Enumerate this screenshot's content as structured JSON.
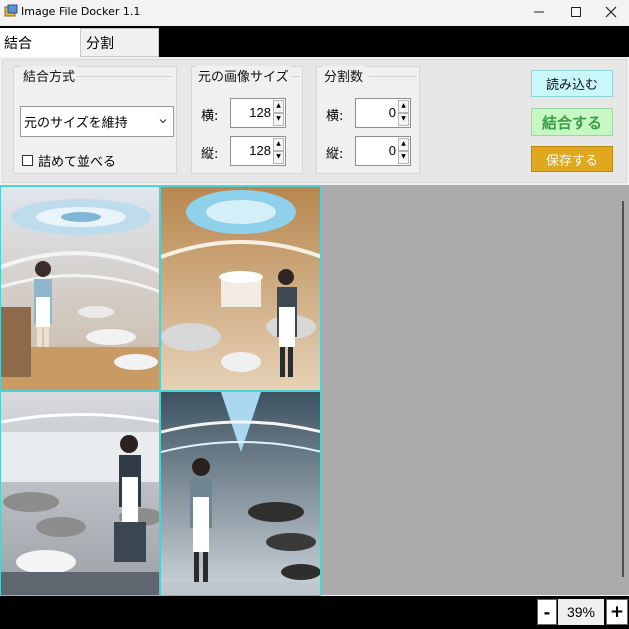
{
  "window": {
    "title": "Image File Docker 1.1"
  },
  "tabs": [
    {
      "label": "結合",
      "active": true
    },
    {
      "label": "分割",
      "active": false
    }
  ],
  "combine_method": {
    "title": "結合方式",
    "selected": "元のサイズを維持",
    "pack_checkbox_label": "詰めて並べる",
    "pack_checked": false
  },
  "source_size": {
    "title": "元の画像サイズ",
    "width_label": "横:",
    "width_value": "128",
    "height_label": "縦:",
    "height_value": "128"
  },
  "split_count": {
    "title": "分割数",
    "horizontal_label": "横:",
    "horizontal_value": "0",
    "vertical_label": "縦:",
    "vertical_value": "0"
  },
  "actions": {
    "load_label": "読み込む",
    "combine_label": "結合する",
    "save_label": "保存する"
  },
  "zoom": {
    "minus": "-",
    "value": "39%",
    "plus": "+"
  },
  "colors": {
    "load_button": "#c9f8fb",
    "combine_button": "#c7f8c4",
    "combine_text": "#3a9e4a",
    "save_button": "#e0a81f",
    "tile_border": "#4bd1d1",
    "preview_background": "#aaaaaa"
  }
}
